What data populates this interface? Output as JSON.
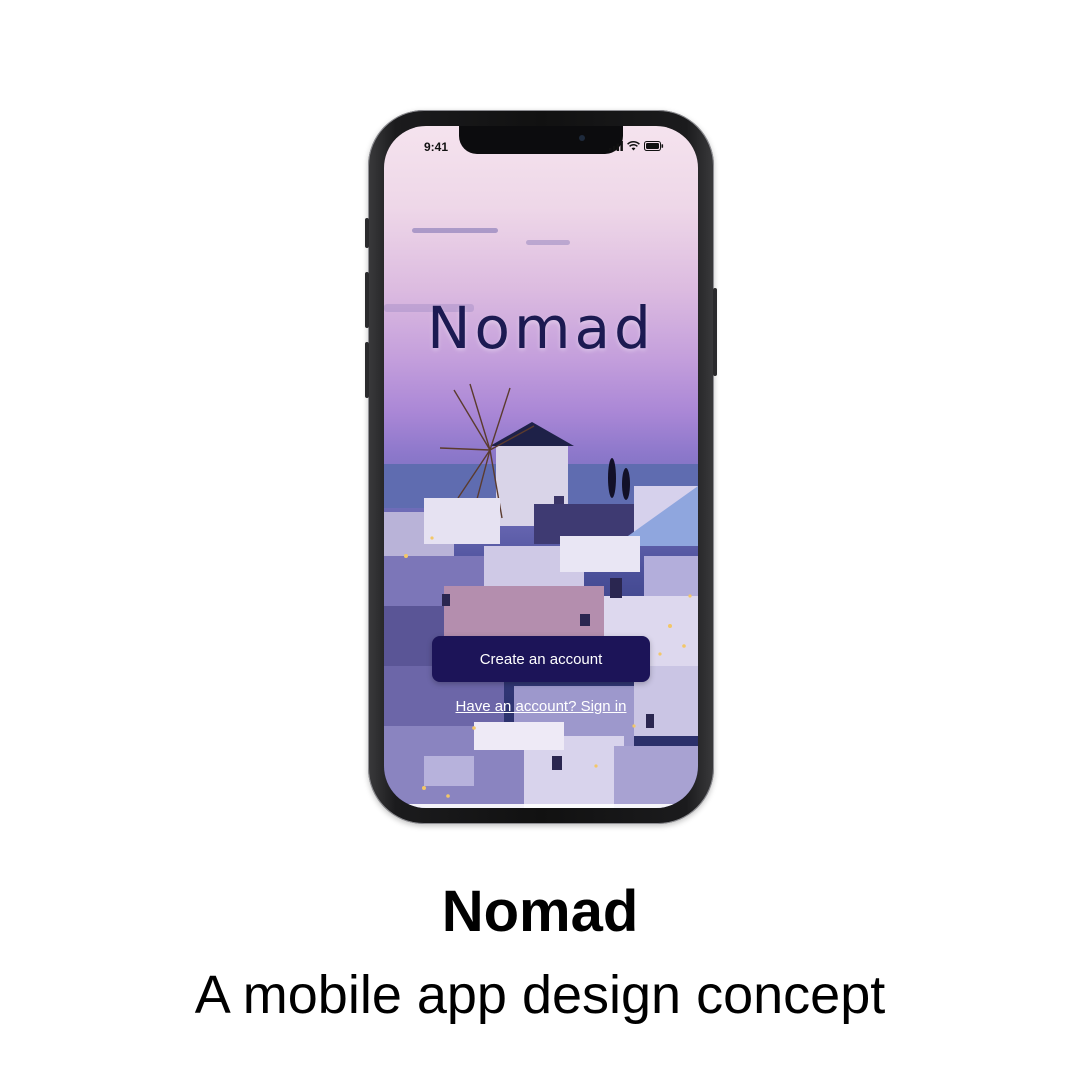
{
  "status_bar": {
    "time": "9:41",
    "icons": [
      "signal-icon",
      "wifi-icon",
      "battery-icon"
    ]
  },
  "app": {
    "brand": "Nomad",
    "create_account_label": "Create an account",
    "sign_in_label": "Have an account? Sign in"
  },
  "caption": {
    "title": "Nomad",
    "subtitle": "A mobile app design concept"
  },
  "colors": {
    "primary_button": "#1c1458",
    "brand_text": "#1c1a52",
    "background": "#ffffff"
  }
}
